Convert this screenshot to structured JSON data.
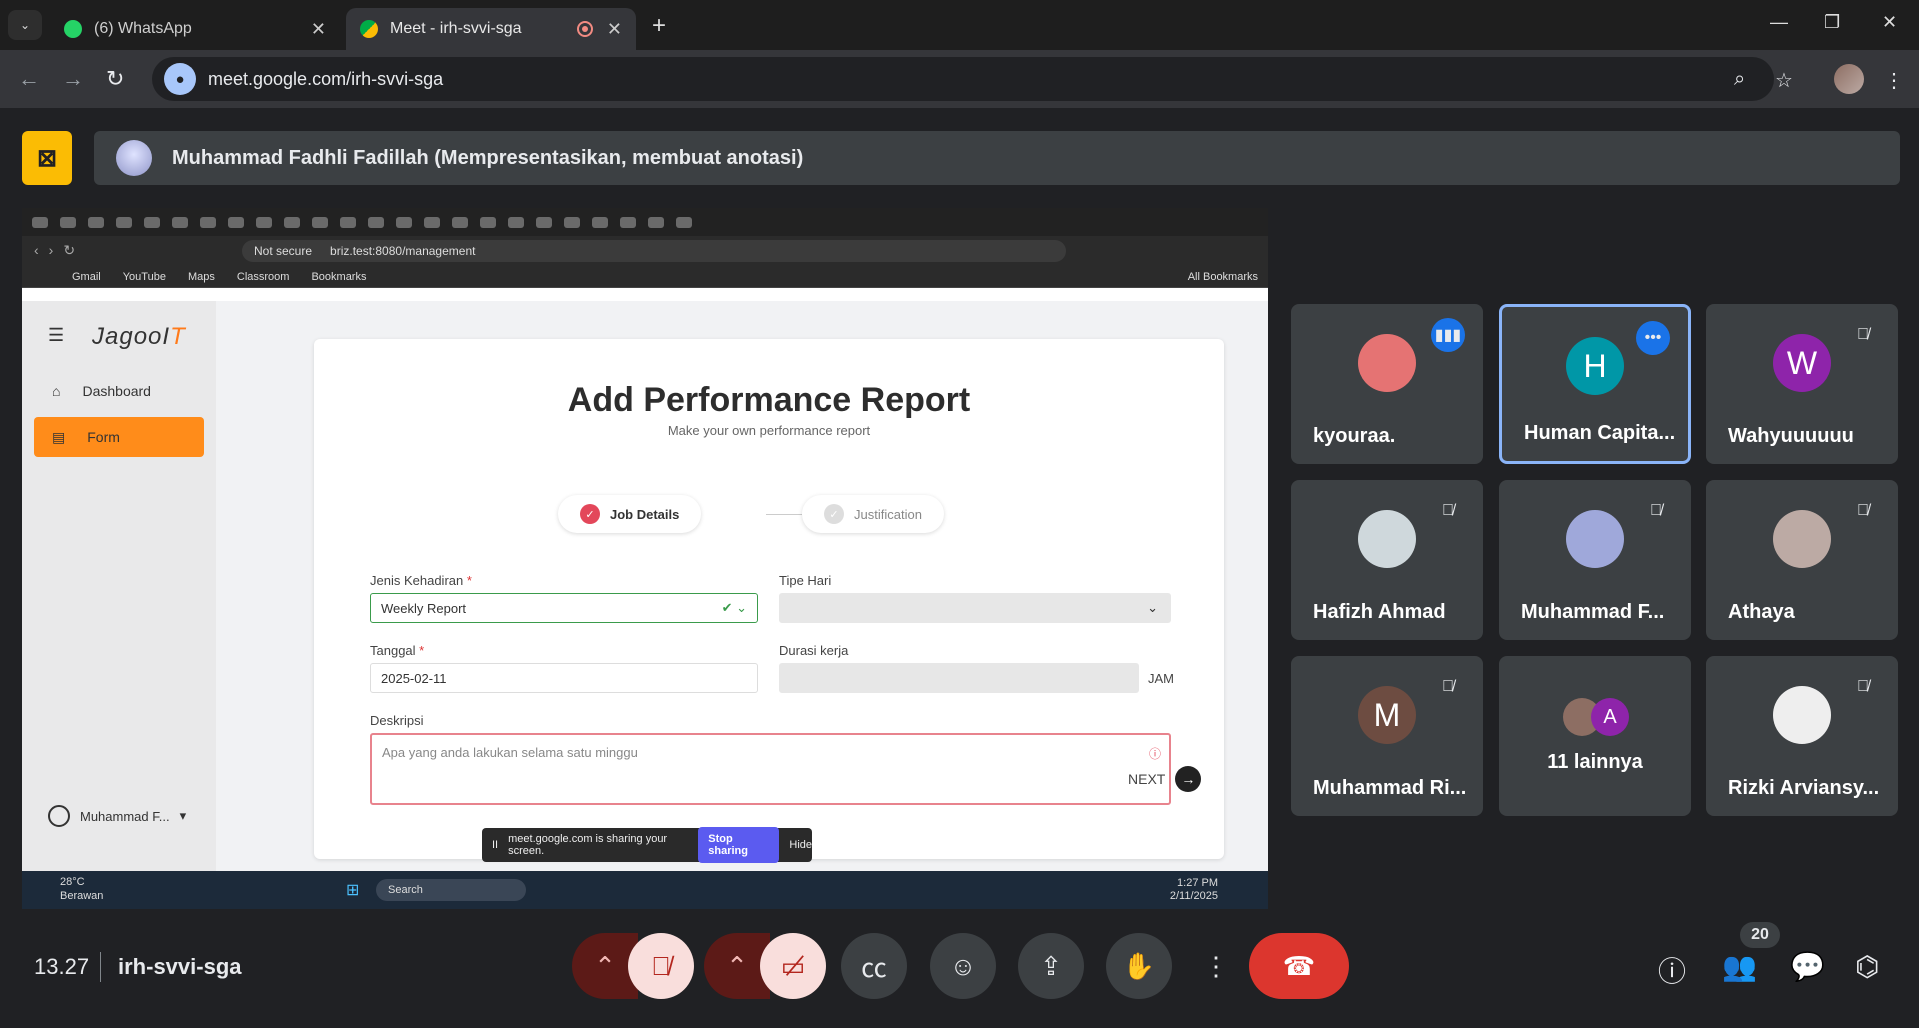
{
  "browser": {
    "tabs": [
      {
        "title": "(6) WhatsApp",
        "icon": "whatsapp-icon",
        "color": "#25d366"
      },
      {
        "title": "Meet - irh-svvi-sga",
        "icon": "google-meet-icon",
        "color": "#00ac47"
      }
    ],
    "url": "meet.google.com/irh-svvi-sga"
  },
  "presenter": {
    "label": "Muhammad Fadhli Fadillah (Mempresentasikan, membuat anotasi)"
  },
  "shared_screen": {
    "address": {
      "security": "Not secure",
      "url": "briz.test:8080/management"
    },
    "bookmarks": [
      "Gmail",
      "YouTube",
      "Maps",
      "Classroom",
      "Bookmarks"
    ],
    "all_bookmarks": "All Bookmarks",
    "app": {
      "logo_main": "JagooI",
      "logo_accent": "T",
      "sidebar": [
        {
          "label": "Dashboard",
          "icon": "home-icon"
        },
        {
          "label": "Form",
          "icon": "form-icon"
        }
      ],
      "user": "Muhammad F..."
    },
    "form": {
      "title": "Add Performance Report",
      "subtitle": "Make your own performance report",
      "steps": [
        "Job Details",
        "Justification"
      ],
      "jenis_label": "Jenis Kehadiran",
      "jenis_value": "Weekly Report",
      "tipe_label": "Tipe Hari",
      "tanggal_label": "Tanggal",
      "tanggal_value": "2025-02-11",
      "durasi_label": "Durasi kerja",
      "durasi_unit": "JAM",
      "deskripsi_label": "Deskripsi",
      "deskripsi_placeholder": "Apa yang anda lakukan selama satu minggu",
      "required_mark": "*",
      "next_label": "NEXT"
    },
    "sharing_bar": {
      "text": "meet.google.com is sharing your screen.",
      "stop": "Stop sharing",
      "hide": "Hide"
    },
    "taskbar": {
      "temp": "28°C",
      "weather": "Berawan",
      "search": "Search",
      "time": "1:27 PM",
      "date": "2/11/2025"
    }
  },
  "participants": [
    {
      "name": "kyouraa.",
      "initial": "",
      "avatar_color": "#e57373",
      "status": "speaking"
    },
    {
      "name": "Human Capita...",
      "initial": "H",
      "avatar_color": "#0097a7",
      "status": "more"
    },
    {
      "name": "Wahyuuuuuu",
      "initial": "W",
      "avatar_color": "#8e24aa",
      "status": "muted"
    },
    {
      "name": "Hafizh Ahmad",
      "initial": "",
      "avatar_color": "#cfd8dc",
      "status": "muted"
    },
    {
      "name": "Muhammad F...",
      "initial": "",
      "avatar_color": "#9fa8da",
      "status": "muted"
    },
    {
      "name": "Athaya",
      "initial": "",
      "avatar_color": "#bcaaa4",
      "status": "muted"
    },
    {
      "name": "Muhammad Ri...",
      "initial": "M",
      "avatar_color": "#6d4c41",
      "status": "muted"
    },
    {
      "name": "11 lainnya",
      "initial": "A",
      "avatar_color": "#8e24aa",
      "status": ""
    },
    {
      "name": "Rizki Arviansy...",
      "initial": "",
      "avatar_color": "#eeeeee",
      "status": "muted"
    }
  ],
  "meeting": {
    "time": "13.27",
    "code": "irh-svvi-sga",
    "participant_count": "20"
  }
}
